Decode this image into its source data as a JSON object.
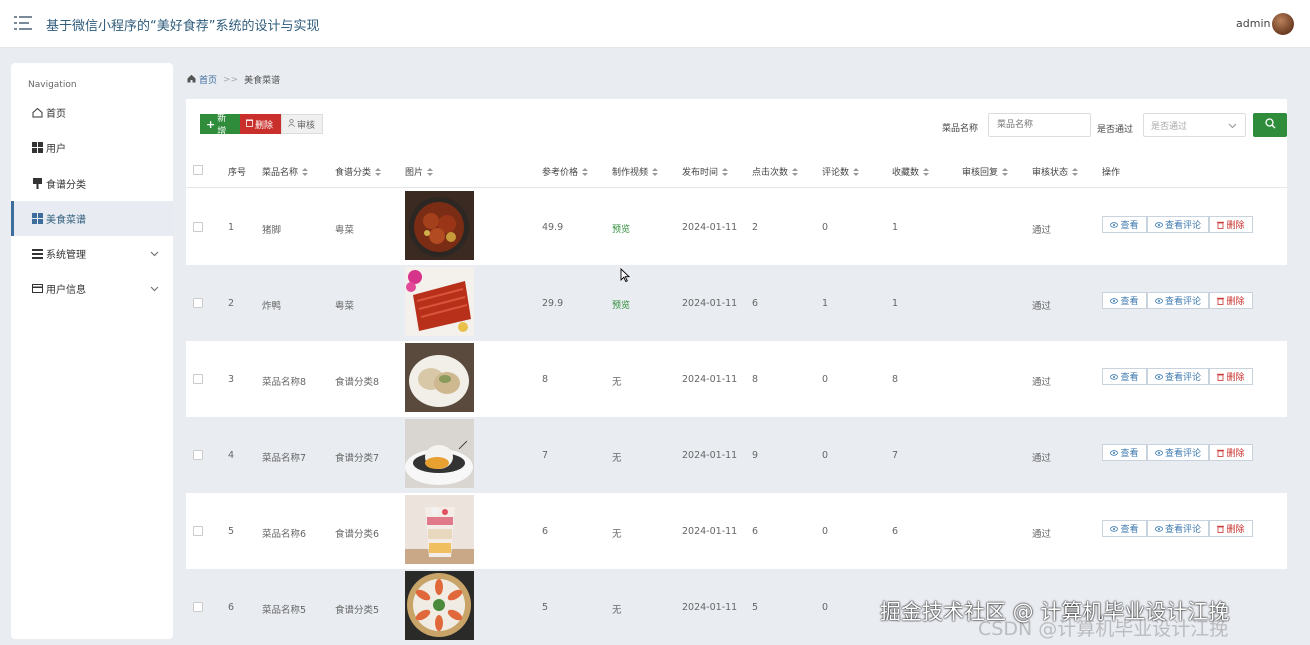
{
  "header": {
    "title": "基于微信小程序的“美好食荐”系统的设计与实现",
    "username": "admin"
  },
  "sidebar": {
    "heading": "Navigation",
    "items": [
      {
        "label": "首页",
        "icon": "home-icon"
      },
      {
        "label": "用户",
        "icon": "grid-icon"
      },
      {
        "label": "食谱分类",
        "icon": "pin-icon"
      },
      {
        "label": "美食菜谱",
        "icon": "grid-icon",
        "active": true
      },
      {
        "label": "系统管理",
        "icon": "list-icon",
        "expandable": true
      },
      {
        "label": "用户信息",
        "icon": "card-icon",
        "expandable": true
      }
    ]
  },
  "breadcrumb": {
    "home": "首页",
    "separator": ">>",
    "current": "美食菜谱"
  },
  "toolbar": {
    "add_label": "新增",
    "delete_label": "删除",
    "audit_label": "审核"
  },
  "search": {
    "name_label": "菜品名称",
    "name_placeholder": "菜品名称",
    "pass_label": "是否通过",
    "pass_placeholder": "是否通过"
  },
  "table": {
    "columns": [
      "序号",
      "菜品名称",
      "食谱分类",
      "图片",
      "参考价格",
      "制作视频",
      "发布时间",
      "点击次数",
      "评论数",
      "收藏数",
      "审核回复",
      "审核状态",
      "操作"
    ],
    "rows": [
      {
        "no": "1",
        "name": "猪脚",
        "category": "粤菜",
        "image": "braised-pork-trotters",
        "price": "49.9",
        "video": "预览",
        "date": "2024-01-11",
        "clicks": "2",
        "comments": "0",
        "favorites": "1",
        "reply": "",
        "status": "通过"
      },
      {
        "no": "2",
        "name": "炸鸭",
        "category": "粤菜",
        "image": "roast-duck",
        "price": "29.9",
        "video": "预览",
        "date": "2024-01-11",
        "clicks": "6",
        "comments": "1",
        "favorites": "1",
        "reply": "",
        "status": "通过"
      },
      {
        "no": "3",
        "name": "菜品名称8",
        "category": "食谱分类8",
        "image": "dumplings-plate",
        "price": "8",
        "video": "无",
        "date": "2024-01-11",
        "clicks": "8",
        "comments": "0",
        "favorites": "8",
        "reply": "",
        "status": "通过"
      },
      {
        "no": "4",
        "name": "菜品名称7",
        "category": "食谱分类7",
        "image": "mousse-dessert",
        "price": "7",
        "video": "无",
        "date": "2024-01-11",
        "clicks": "9",
        "comments": "0",
        "favorites": "7",
        "reply": "",
        "status": "通过"
      },
      {
        "no": "5",
        "name": "菜品名称6",
        "category": "食谱分类6",
        "image": "parfait-cup",
        "price": "6",
        "video": "无",
        "date": "2024-01-11",
        "clicks": "6",
        "comments": "0",
        "favorites": "6",
        "reply": "",
        "status": "通过"
      },
      {
        "no": "6",
        "name": "菜品名称5",
        "category": "食谱分类5",
        "image": "shrimp-platter",
        "price": "5",
        "video": "无",
        "date": "2024-01-11",
        "clicks": "5",
        "comments": "0",
        "favorites": "",
        "reply": "",
        "status": ""
      }
    ],
    "actions": {
      "view": "查看",
      "review": "查看评论",
      "delete": "删除"
    }
  },
  "watermark": {
    "main": "掘金技术社区 @ 计算机毕业设计江挽",
    "secondary": "CSDN @计算机毕业设计江挽"
  },
  "colors": {
    "primary_green": "#2f8c3a",
    "danger_red": "#c9302c",
    "link_blue": "#3d7ab0",
    "title_blue": "#2f5d7c"
  }
}
